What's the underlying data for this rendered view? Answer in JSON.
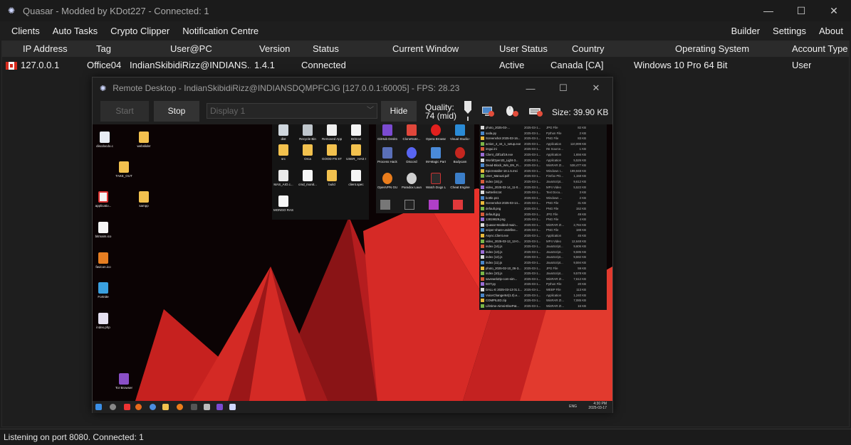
{
  "window": {
    "title": "Quasar - Modded by KDot227 - Connected: 1",
    "minimize_glyph": "—",
    "maximize_glyph": "☐",
    "close_glyph": "✕"
  },
  "menu": {
    "left": [
      "Clients",
      "Auto Tasks",
      "Crypto Clipper",
      "Notification Centre"
    ],
    "right": [
      "Builder",
      "Settings",
      "About"
    ]
  },
  "grid": {
    "columns": [
      "IP Address",
      "Tag",
      "User@PC",
      "Version",
      "Status",
      "Current Window",
      "User Status",
      "Country",
      "Operating System",
      "Account Type"
    ],
    "rows": [
      {
        "ip": "127.0.0.1",
        "tag": "Office04",
        "user_pc": "IndianSkibidiRizz@INDIANS...",
        "version": "1.4.1",
        "status": "Connected",
        "current_window": "",
        "user_status": "Active",
        "country": "Canada [CA]",
        "os": "Windows 10 Pro 64 Bit",
        "account_type": "User"
      }
    ]
  },
  "statusbar": {
    "text": "Listening on port 8080.  Connected: 1"
  },
  "remote_desktop": {
    "title": "Remote Desktop - IndianSkibidiRizz@INDIANSDQMPFCJG [127.0.0.1:60005] - FPS: 28.23",
    "start_label": "Start",
    "stop_label": "Stop",
    "display_select": "Display 1",
    "hide_label": "Hide",
    "quality_label": "Quality:",
    "quality_value": "74 (mid)",
    "quality_level": 74,
    "size_label": "Size: 39.90 KB",
    "remote_screen": {
      "desktop_icons_left": [
        "discdocdo.c",
        "webslider",
        "TAKE_OUT",
        "applicatio...",
        "sampp",
        "bitmaim.ico",
        "favicon.ico",
        "Fortnite",
        "index.php",
        "Tor Browser"
      ],
      "folder_icons": [
        "dist",
        "Recycle Bin",
        "Removed Apps.html",
        "Britt.txt",
        "src",
        "Orca",
        "GOOD FN STEVE",
        "USER_ HAS GOOD FN...",
        "MAS_AIO.c...",
        "cmd_monit...",
        "build",
        "client.spec",
        "MONGO RASS.txt"
      ],
      "app_icons": [
        "GitHub Desktop",
        "CloneNote...",
        "Opera Browser",
        "Visual Studio Code",
        "Process Hacker 2",
        "Discord",
        "IM-Magic Partition...",
        "Bodycam",
        "OpenVPN GUI",
        "Paradox Launcher v2",
        "Watch Dogs Legion",
        "Cheat Engine"
      ],
      "files": [
        [
          "photo_2025-03-...",
          "2025-03-1...",
          "JPG File",
          "82 KB"
        ],
        [
          "soda.py",
          "2025-03-1...",
          "Python File",
          "2 KB"
        ],
        [
          "Screenshot 2025-03-16...",
          "2025-03-1...",
          "PNG File",
          "83 KB"
        ],
        [
          "action_4_44_1_setup.exe",
          "2025-03-1...",
          "Application",
          "110,999 KB"
        ],
        [
          "imgui.ini",
          "2025-03-1...",
          "INI Source...",
          "1 KB"
        ],
        [
          "Client_d3f1af19.exe",
          "2025-03-1...",
          "Application",
          "1,656 KB"
        ],
        [
          "WorldOpen33_Light-3...",
          "2025-03-1...",
          "Application",
          "5,526 KB"
        ],
        [
          "Dead-Block_Win_EN_Fi...",
          "2025-03-1...",
          "WinRAR ZI...",
          "538,477 KB"
        ],
        [
          "EpicInstaller-18.1.5.msi",
          "2025-03-1...",
          "Windows I...",
          "199,948 KB"
        ],
        [
          "User_Manual.pdf",
          "2025-03-1...",
          "Firefox PD...",
          "1,158 KB"
        ],
        [
          "index (15).js",
          "2025-03-1...",
          "JavaScript...",
          "9,612 KB"
        ],
        [
          "video_2025-03-14_11-0...",
          "2025-03-1...",
          "MP4 Video",
          "5,522 KB"
        ],
        [
          "twitterlist.txt",
          "2025-03-1...",
          "Text Docu...",
          "3 KB"
        ],
        [
          "bottle.ps1",
          "2025-03-1...",
          "Windows ...",
          "2 KB"
        ],
        [
          "Screenshot 2025-03-14...",
          "2025-03-1...",
          "PNG File",
          "31 KB"
        ],
        [
          "default.png",
          "2025-03-1...",
          "PNG File",
          "152 KB"
        ],
        [
          "default.jpg",
          "2025-03-1...",
          "JPG File",
          "49 KB"
        ],
        [
          "13819829.png",
          "2025-03-1...",
          "PNG File",
          "4 KB"
        ],
        [
          "Quasar-Modded-main...",
          "2025-03-1...",
          "WinRAR ZI...",
          "2,784 KB"
        ],
        [
          "sniper-share-undefine...",
          "2025-03-1...",
          "PNG File",
          "188 KB"
        ],
        [
          "Async.Client.exe",
          "2025-03-1...",
          "Application",
          "45 KB"
        ],
        [
          "video_2025-03-13_13-0...",
          "2025-03-1...",
          "MP4 Video",
          "12,648 KB"
        ],
        [
          "index (14).js",
          "2025-03-1...",
          "JavaScript...",
          "9,606 KB"
        ],
        [
          "index (13).js",
          "2025-03-1...",
          "JavaScript...",
          "9,595 KB"
        ],
        [
          "index (12).js",
          "2025-03-1...",
          "JavaScript...",
          "9,592 KB"
        ],
        [
          "index (11).js",
          "2025-03-1...",
          "JavaScript...",
          "9,594 KB"
        ],
        [
          "photo_2025-02-10_06-3...",
          "2025-03-1...",
          "JPG File",
          "59 KB"
        ],
        [
          "index (10).js",
          "2025-03-1...",
          "JavaScript...",
          "9,578 KB"
        ],
        [
          "savewebZip-com-sim...",
          "2025-03-1...",
          "WinRAR ZI...",
          "7,612 KB"
        ],
        [
          "BOT.py",
          "2025-03-1...",
          "Python File",
          "20 KB"
        ],
        [
          "DALL-E 2025-03-13 01.1...",
          "2025-03-1...",
          "WEBP File",
          "113 KB"
        ],
        [
          "VoiceChanger64(1.0).e...",
          "2025-03-1...",
          "Application",
          "1,240 KB"
        ],
        [
          "COMPILED.zip",
          "2025-03-1...",
          "WinRAR ZI...",
          "7,085 KB"
        ],
        [
          "Lifetime-Aimsi-ElsePat...",
          "2025-03-1...",
          "WinRAR ZI...",
          "16 KB"
        ]
      ],
      "clock_time": "4:30 PM",
      "clock_date": "2025-03-17",
      "lang": "ENG"
    }
  },
  "colors": {
    "accent_red": "#e8322b",
    "dark_red": "#7a0d0f",
    "window_bg": "#1e1e1e",
    "header_bg": "#2b2b2b"
  }
}
